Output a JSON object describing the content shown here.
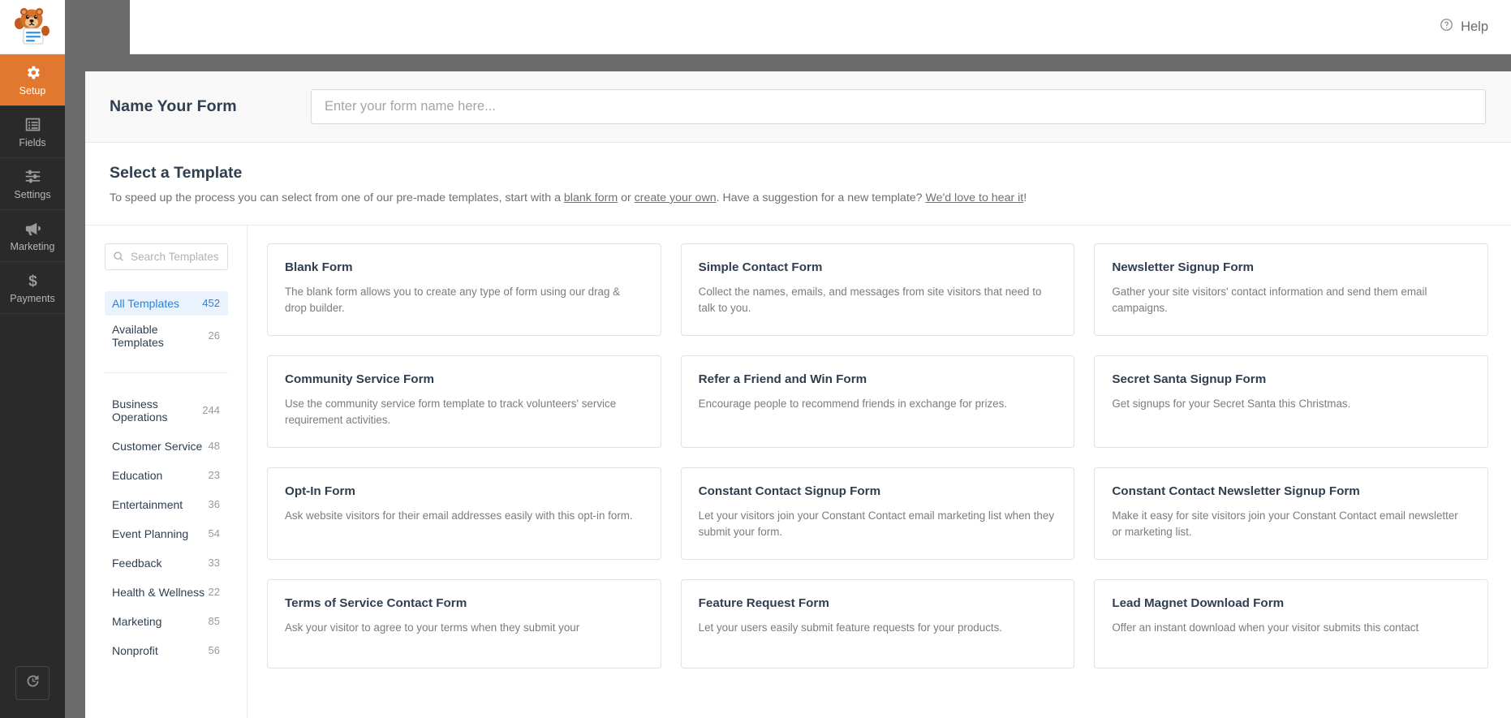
{
  "topbar": {
    "help_label": "Help",
    "help_icon": "question-circle-icon"
  },
  "sidebar": {
    "logo_icon": "wpforms-bear-logo",
    "items": [
      {
        "label": "Setup",
        "icon": "gear-icon",
        "active": true
      },
      {
        "label": "Fields",
        "icon": "list-icon",
        "active": false
      },
      {
        "label": "Settings",
        "icon": "sliders-icon",
        "active": false
      },
      {
        "label": "Marketing",
        "icon": "megaphone-icon",
        "active": false
      },
      {
        "label": "Payments",
        "icon": "dollar-icon",
        "active": false
      }
    ],
    "revision_icon": "revision-history-icon",
    "active_color": "#e27730"
  },
  "form_name": {
    "label": "Name Your Form",
    "placeholder": "Enter your form name here...",
    "value": ""
  },
  "select_template": {
    "title": "Select a Template",
    "desc_part1": "To speed up the process you can select from one of our pre-made templates, start with a ",
    "link_blank": "blank form",
    "desc_or": " or ",
    "link_create": "create your own",
    "desc_part2": ". Have a suggestion for a new template? ",
    "link_suggest": "We'd love to hear it",
    "desc_end": "!"
  },
  "search": {
    "placeholder": "Search Templates",
    "value": "",
    "icon": "search-icon"
  },
  "filters": {
    "primary": [
      {
        "label": "All Templates",
        "count": "452",
        "active": true
      },
      {
        "label": "Available Templates",
        "count": "26",
        "active": false
      }
    ],
    "categories": [
      {
        "label": "Business Operations",
        "count": "244"
      },
      {
        "label": "Customer Service",
        "count": "48"
      },
      {
        "label": "Education",
        "count": "23"
      },
      {
        "label": "Entertainment",
        "count": "36"
      },
      {
        "label": "Event Planning",
        "count": "54"
      },
      {
        "label": "Feedback",
        "count": "33"
      },
      {
        "label": "Health & Wellness",
        "count": "22"
      },
      {
        "label": "Marketing",
        "count": "85"
      },
      {
        "label": "Nonprofit",
        "count": "56"
      }
    ]
  },
  "templates": [
    {
      "title": "Blank Form",
      "desc": "The blank form allows you to create any type of form using our drag & drop builder."
    },
    {
      "title": "Simple Contact Form",
      "desc": "Collect the names, emails, and messages from site visitors that need to talk to you."
    },
    {
      "title": "Newsletter Signup Form",
      "desc": "Gather your site visitors' contact information and send them email campaigns."
    },
    {
      "title": "Community Service Form",
      "desc": "Use the community service form template to track volunteers' service requirement activities."
    },
    {
      "title": "Refer a Friend and Win Form",
      "desc": "Encourage people to recommend friends in exchange for prizes."
    },
    {
      "title": "Secret Santa Signup Form",
      "desc": "Get signups for your Secret Santa this Christmas."
    },
    {
      "title": "Opt-In Form",
      "desc": "Ask website visitors for their email addresses easily with this opt-in form."
    },
    {
      "title": "Constant Contact Signup Form",
      "desc": "Let your visitors join your Constant Contact email marketing list when they submit your form."
    },
    {
      "title": "Constant Contact Newsletter Signup Form",
      "desc": "Make it easy for site visitors join your Constant Contact email newsletter or marketing list."
    },
    {
      "title": "Terms of Service Contact Form",
      "desc": "Ask your visitor to agree to your terms when they submit your"
    },
    {
      "title": "Feature Request Form",
      "desc": "Let your users easily submit feature requests for your products."
    },
    {
      "title": "Lead Magnet Download Form",
      "desc": "Offer an instant download when your visitor submits this contact"
    }
  ]
}
